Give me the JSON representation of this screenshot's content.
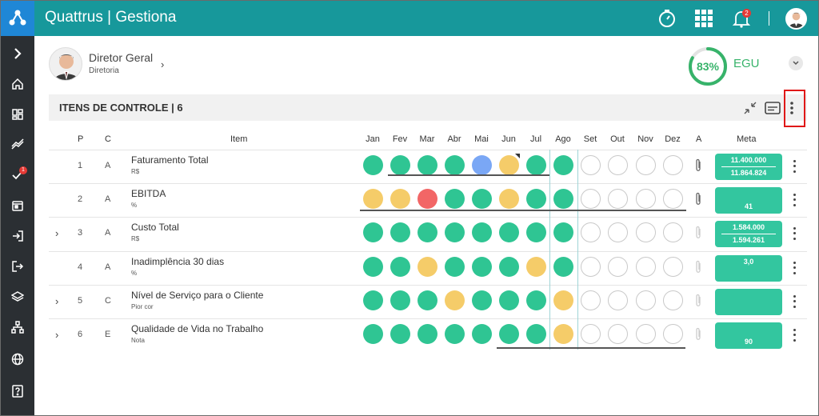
{
  "app": {
    "title": "Quattrus | Gestiona"
  },
  "topbar": {
    "notification_count": "2",
    "icons": [
      "timer-icon",
      "apps-grid-icon",
      "bell-icon",
      "user-avatar"
    ]
  },
  "sidebar": {
    "items": [
      {
        "name": "expand-icon"
      },
      {
        "name": "home-icon"
      },
      {
        "name": "dashboard-icon"
      },
      {
        "name": "trend-icon"
      },
      {
        "name": "tasks-icon",
        "badge": "1"
      },
      {
        "name": "calendar-icon"
      },
      {
        "name": "login-icon"
      },
      {
        "name": "logout-icon"
      },
      {
        "name": "layers-icon"
      },
      {
        "name": "hierarchy-icon"
      },
      {
        "name": "globe-icon"
      },
      {
        "name": "help-icon"
      }
    ]
  },
  "profile": {
    "name": "Diretor Geral",
    "subtitle": "Diretoria"
  },
  "egu": {
    "percent": "83%",
    "label": "EGU",
    "value": 0.83,
    "color": "#37b36a"
  },
  "section": {
    "title": "ITENS DE CONTROLE | 6"
  },
  "table": {
    "headers": {
      "p": "P",
      "c": "C",
      "item": "Item",
      "a": "A",
      "meta": "Meta"
    },
    "months": [
      "Jan",
      "Fev",
      "Mar",
      "Abr",
      "Mai",
      "Jun",
      "Jul",
      "Ago",
      "Set",
      "Out",
      "Nov",
      "Dez"
    ],
    "rows": [
      {
        "p": "1",
        "c": "A",
        "name": "Faturamento Total",
        "unit": "R$",
        "expandable": false,
        "status": [
          "g",
          "g",
          "g",
          "g",
          "b",
          "y",
          "g",
          "g",
          "e",
          "e",
          "e",
          "e"
        ],
        "meta_top": "11.400.000",
        "meta_bottom": "11.864.824",
        "attachment": "active"
      },
      {
        "p": "2",
        "c": "A",
        "name": "EBITDA",
        "unit": "%",
        "expandable": false,
        "status": [
          "y",
          "y",
          "r",
          "g",
          "g",
          "y",
          "g",
          "g",
          "e",
          "e",
          "e",
          "e"
        ],
        "meta_top": "",
        "meta_bottom": "41",
        "attachment": "active"
      },
      {
        "p": "3",
        "c": "A",
        "name": "Custo Total",
        "unit": "R$",
        "expandable": true,
        "status": [
          "g",
          "g",
          "g",
          "g",
          "g",
          "g",
          "g",
          "g",
          "e",
          "e",
          "e",
          "e"
        ],
        "meta_top": "1.584.000",
        "meta_bottom": "1.594.261",
        "attachment": "inactive"
      },
      {
        "p": "4",
        "c": "A",
        "name": "Inadimplência 30 dias",
        "unit": "%",
        "expandable": false,
        "status": [
          "g",
          "g",
          "y",
          "g",
          "g",
          "g",
          "y",
          "g",
          "e",
          "e",
          "e",
          "e"
        ],
        "meta_top": "3,0",
        "meta_bottom": "",
        "attachment": "inactive"
      },
      {
        "p": "5",
        "c": "C",
        "name": "Nível de Serviço para o Cliente",
        "unit": "Pior cor",
        "expandable": true,
        "status": [
          "g",
          "g",
          "g",
          "y",
          "g",
          "g",
          "g",
          "y",
          "e",
          "e",
          "e",
          "e"
        ],
        "meta_top": "",
        "meta_bottom": "",
        "attachment": "inactive"
      },
      {
        "p": "6",
        "c": "E",
        "name": "Qualidade de Vida no Trabalho",
        "unit": "Nota",
        "expandable": true,
        "status": [
          "g",
          "g",
          "g",
          "g",
          "g",
          "g",
          "g",
          "y",
          "e",
          "e",
          "e",
          "e"
        ],
        "meta_top": "",
        "meta_bottom": "90",
        "attachment": "inactive"
      }
    ]
  },
  "colors": {
    "g": "#2fc593",
    "y": "#f5cc69",
    "r": "#f26666",
    "b": "#7aa7f5",
    "accent": "#17989b",
    "meta": "#33c69f"
  }
}
